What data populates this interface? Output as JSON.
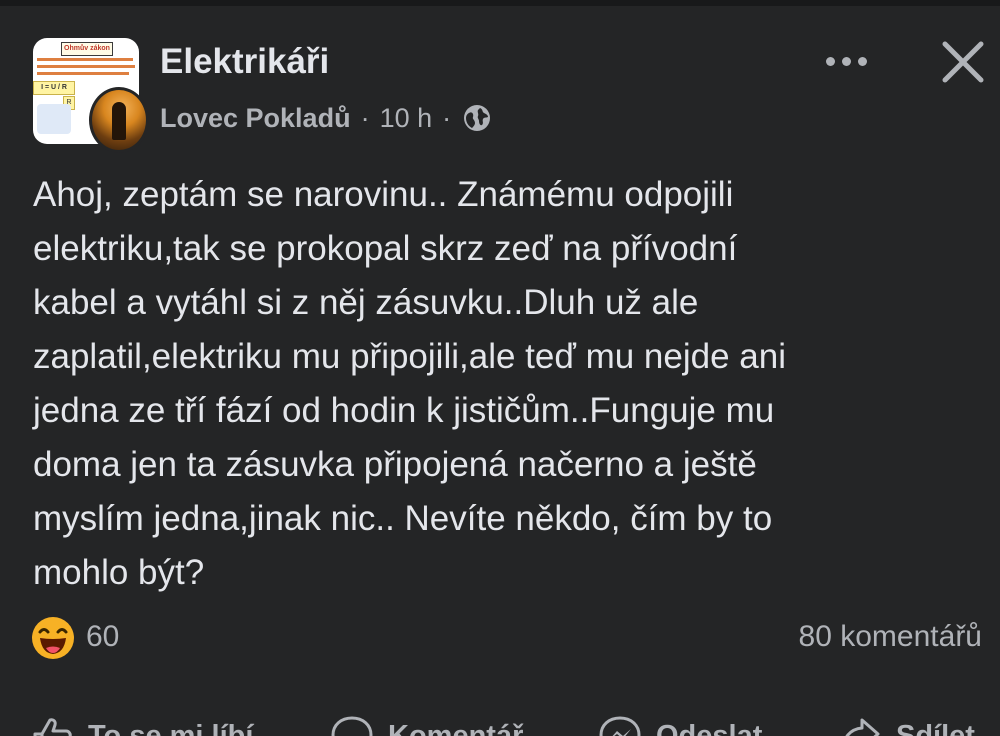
{
  "group": {
    "name": "Elektrikáři",
    "avatar_text": {
      "title": "Ohmův zákon",
      "formula": "I = U / R",
      "r_label": "R"
    }
  },
  "post": {
    "author": "Lovec Pokladů",
    "separator": "·",
    "time": "10 h",
    "privacy_icon": "globe-icon",
    "text": "Ahoj, zeptám se narovinu.. Známému odpojili\nelektriku,tak se prokopal skrz zeď na přívodní\nkabel a vytáhl si z něj zásuvku..Dluh už ale\nzaplatil,elektriku mu připojili,ale teď mu nejde ani\njedna ze tří fází od hodin k jističům..Funguje mu\ndoma jen ta zásuvka připojená načerno a ještě\nmyslím jedna,jinak nic.. Nevíte někdo, čím by to\nmohlo být?"
  },
  "reactions": {
    "icon": "laughing-emoji-icon",
    "count": "60"
  },
  "comments": {
    "count_label": "80 komentářů"
  },
  "actions": {
    "like": "To se mi líbí",
    "comment": "Komentář",
    "send": "Odeslat",
    "share": "Sdílet"
  },
  "colors": {
    "background": "#242526",
    "primary_text": "#e4e6eb",
    "secondary_text": "#b0b3b8",
    "emoji_yellow": "#f7b125"
  }
}
